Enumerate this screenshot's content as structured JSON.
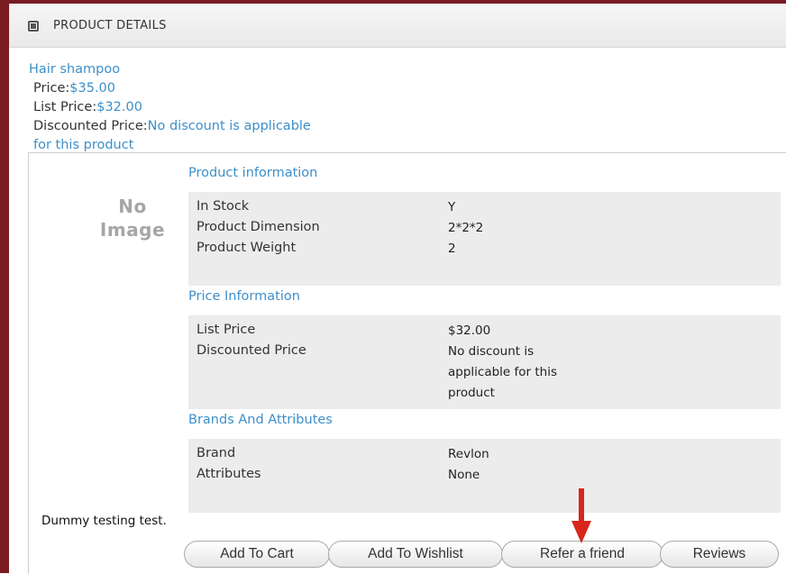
{
  "panel": {
    "title": "PRODUCT DETAILS",
    "header_icon": "expand-square-icon"
  },
  "product": {
    "name": "Hair shampoo",
    "price_label": "Price:",
    "price": "$35.00",
    "list_price_label": "List Price:",
    "list_price": "$32.00",
    "discounted_label": "Discounted Price:",
    "discount_line1": "No discount is applicable",
    "discount_line2": "for this product"
  },
  "image_placeholder": {
    "line1": "No",
    "line2": "Image"
  },
  "sections": {
    "product_info": {
      "title": "Product information",
      "rows": [
        {
          "label": "In Stock",
          "value": "Y"
        },
        {
          "label": "Product Dimension",
          "value": "2*2*2"
        },
        {
          "label": "Product Weight",
          "value": "2"
        }
      ]
    },
    "price_info": {
      "title": "Price Information",
      "rows": [
        {
          "label": "List Price",
          "value": "$32.00"
        },
        {
          "label": "Discounted Price",
          "value_lines": [
            "No discount is",
            "applicable for this",
            "product"
          ]
        }
      ]
    },
    "brands": {
      "title": "Brands And Attributes",
      "rows": [
        {
          "label": "Brand",
          "value": "Revlon"
        },
        {
          "label": "Attributes",
          "value": "None"
        }
      ]
    }
  },
  "description": "Dummy testing test.",
  "buttons": {
    "add_to_cart": "Add To Cart",
    "add_to_wishlist": "Add To Wishlist",
    "refer_friend": "Refer a friend",
    "reviews": "Reviews"
  },
  "annotation": {
    "arrow_icon": "red-down-arrow-icon",
    "arrow_color": "#d9261c"
  },
  "colors": {
    "frame": "#7a1b22",
    "link_blue": "#3d8fc9",
    "grid_bg": "#ececec"
  }
}
